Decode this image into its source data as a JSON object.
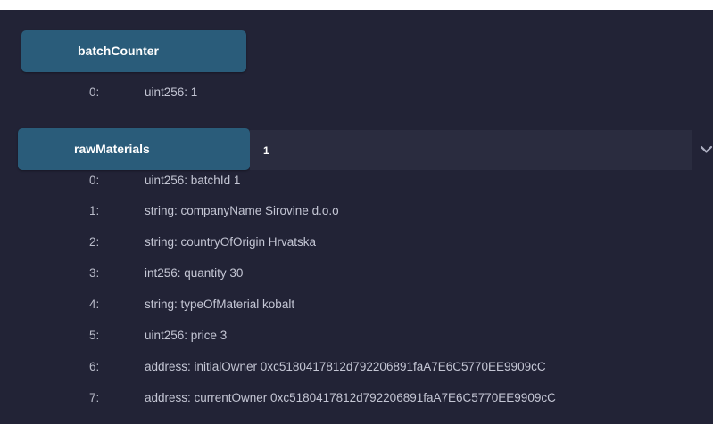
{
  "batchCounter": {
    "label": "batchCounter",
    "outputs": [
      {
        "index": "0:",
        "value": "uint256: 1"
      }
    ]
  },
  "rawMaterials": {
    "label": "rawMaterials",
    "input_value": "1",
    "outputs": [
      {
        "index": "0:",
        "value": "uint256: batchId 1"
      },
      {
        "index": "1:",
        "value": "string: companyName Sirovine d.o.o"
      },
      {
        "index": "2:",
        "value": "string: countryOfOrigin Hrvatska"
      },
      {
        "index": "3:",
        "value": "int256: quantity 30"
      },
      {
        "index": "4:",
        "value": "string: typeOfMaterial kobalt"
      },
      {
        "index": "5:",
        "value": "uint256: price 3"
      },
      {
        "index": "6:",
        "value": "address: initialOwner 0xc5180417812d792206891faA7E6C5770EE9909cC"
      },
      {
        "index": "7:",
        "value": "address: currentOwner 0xc5180417812d792206891faA7E6C5770EE9909cC"
      }
    ]
  },
  "icons": {
    "expand": "chevron-down-icon"
  },
  "colors": {
    "panel_bg": "#222336",
    "button_bg": "#2a5c7a",
    "input_bg": "#2a2c3f",
    "text": "#c4c6d4"
  }
}
